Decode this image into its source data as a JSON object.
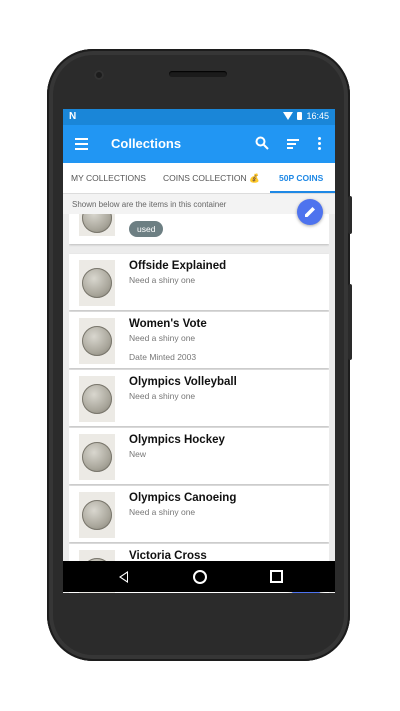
{
  "status_bar": {
    "carrier_icon": "N",
    "time": "16:45"
  },
  "app_bar": {
    "title": "Collections"
  },
  "tabs": [
    {
      "label": "MY COLLECTIONS"
    },
    {
      "label": "COINS COLLECTION 💰"
    },
    {
      "label": "50P COINS"
    }
  ],
  "info": {
    "text": "Shown below are the items in this container"
  },
  "items": [
    {
      "chip": "used"
    },
    {
      "title": "Offside Explained",
      "subtitle": "Need a shiny one",
      "extra": ""
    },
    {
      "title": "Women's Vote",
      "subtitle": "Need a shiny one",
      "extra": "Date Minted 2003"
    },
    {
      "title": "Olympics Volleyball",
      "subtitle": "Need a shiny one",
      "extra": ""
    },
    {
      "title": "Olympics Hockey",
      "subtitle": "New",
      "extra": ""
    },
    {
      "title": "Olympics Canoeing",
      "subtitle": "Need a shiny one",
      "extra": ""
    },
    {
      "title": "Victoria Cross",
      "subtitle": "",
      "extra": ""
    }
  ],
  "fab": {
    "add_symbol": "+"
  },
  "colors": {
    "primary": "#2196f3",
    "status_bar": "#1a86d8",
    "accent": "#4e73ee",
    "chip": "#6d7f83"
  }
}
